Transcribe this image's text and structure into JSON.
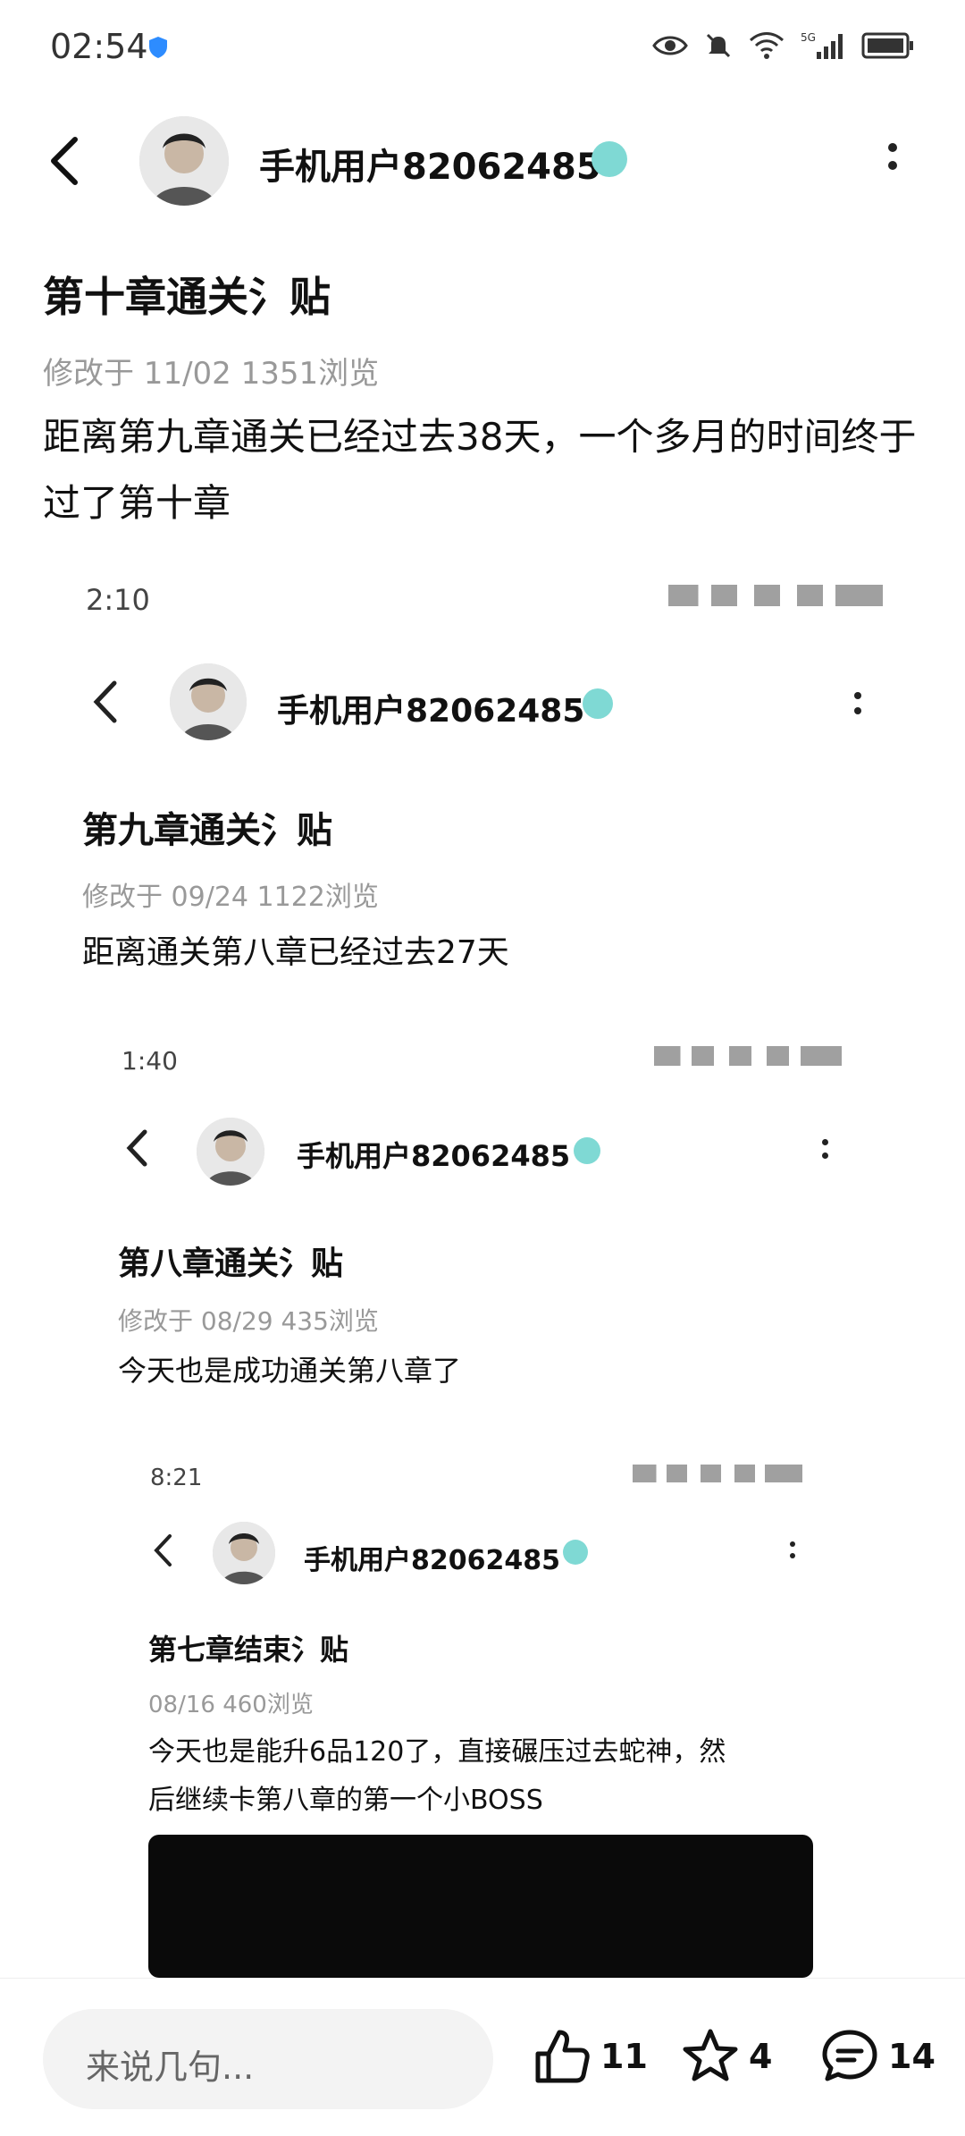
{
  "status_bar": {
    "time": "02:54"
  },
  "header": {
    "username": "手机用户82062485"
  },
  "post": {
    "title": "第十章通关氵贴",
    "meta": "修改于 11/02   1351浏览",
    "body": "距离第九章通关已经过去38天，一个多月的时间终于过了第十章"
  },
  "nested_1": {
    "time": "2:10",
    "username": "手机用户82062485",
    "title": "第九章通关氵贴",
    "meta": "修改于 09/24   1122浏览",
    "body": "距离通关第八章已经过去27天"
  },
  "nested_2": {
    "time": "1:40",
    "username": "手机用户82062485",
    "title": "第八章通关氵贴",
    "meta": "修改于 08/29   435浏览",
    "body": "今天也是成功通关第八章了"
  },
  "nested_3": {
    "time": "8:21",
    "username": "手机用户82062485",
    "title": "第七章结束氵贴",
    "meta": "08/16   460浏览",
    "body_line1": "今天也是能升6品120了，直接碾压过去蛇神，然",
    "body_line2": "后继续卡第八章的第一个小BOSS"
  },
  "bottom_bar": {
    "input_placeholder": "来说几句...",
    "like_count": "11",
    "favorite_count": "4",
    "comment_count": "14"
  },
  "colors": {
    "accent_badge": "#7fd9d4",
    "meta_gray": "#999999"
  }
}
